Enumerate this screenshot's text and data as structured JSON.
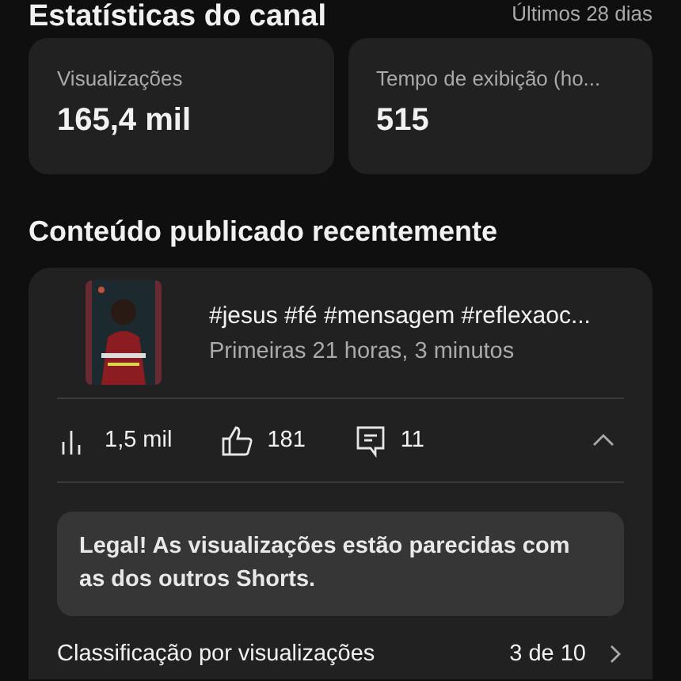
{
  "header": {
    "title": "Estatísticas do canal",
    "period": "Últimos 28 dias"
  },
  "stats": [
    {
      "label": "Visualizações",
      "value": "165,4 mil"
    },
    {
      "label": "Tempo de exibição (ho...",
      "value": "515"
    }
  ],
  "recent": {
    "title": "Conteúdo publicado recentemente",
    "video": {
      "title": "#jesus #fé #mensagem #reflexaoc...",
      "subtitle": "Primeiras 21 horas, 3 minutos",
      "metrics": [
        {
          "kind": "views",
          "value": "1,5 mil"
        },
        {
          "kind": "likes",
          "value": "181"
        },
        {
          "kind": "comments",
          "value": "11"
        }
      ],
      "expanded": true,
      "insight": "Legal! As visualizações estão parecidas com as dos outros Shorts.",
      "ranking": {
        "label": "Classificação por visualizações",
        "value": "3 de 10"
      }
    }
  }
}
